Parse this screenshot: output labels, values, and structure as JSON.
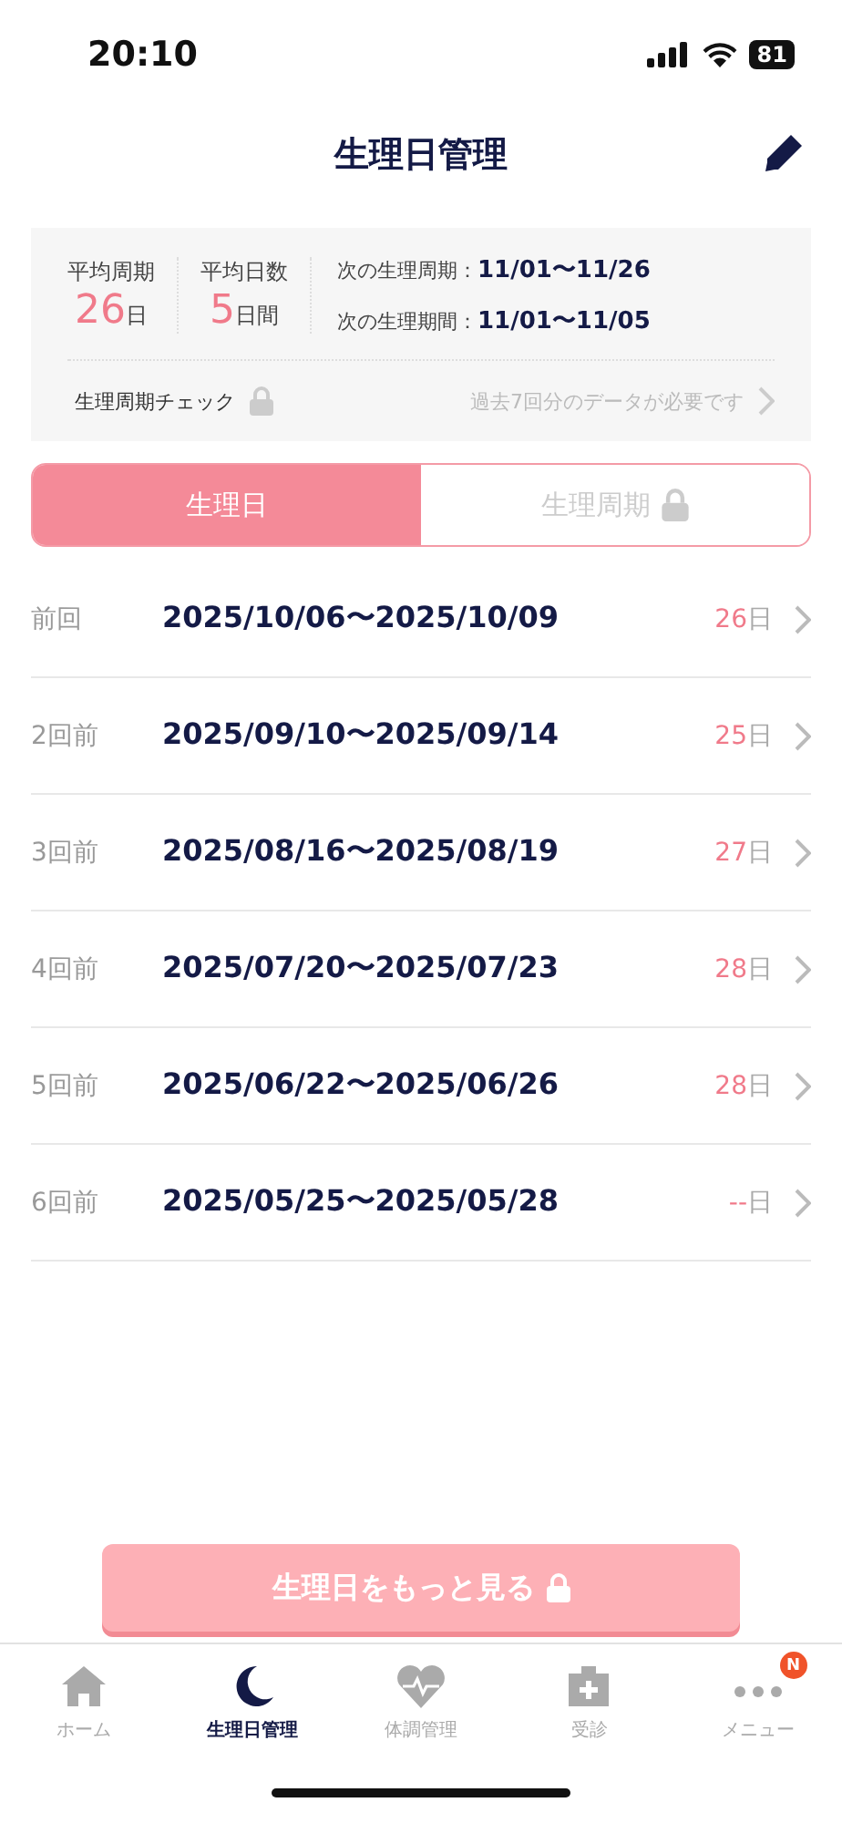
{
  "status_bar": {
    "time": "20:10",
    "battery": "81"
  },
  "header": {
    "title": "生理日管理"
  },
  "summary": {
    "stats": [
      {
        "label": "平均周期",
        "value": "26",
        "unit": "日"
      },
      {
        "label": "平均日数",
        "value": "5",
        "unit": "日間"
      }
    ],
    "next": [
      {
        "label": "次の生理周期：",
        "value": "11/01〜11/26"
      },
      {
        "label": "次の生理期間：",
        "value": "11/01〜11/05"
      }
    ],
    "check": {
      "label": "生理周期チェック",
      "locked": true,
      "note": "過去7回分のデータが必要です"
    }
  },
  "tabs": [
    {
      "label": "生理日",
      "selected": true,
      "locked": false
    },
    {
      "label": "生理周期",
      "selected": false,
      "locked": true
    }
  ],
  "rows": [
    {
      "label": "前回",
      "range": "2025/10/06〜2025/10/09",
      "days": "26",
      "unit": "日"
    },
    {
      "label": "2回前",
      "range": "2025/09/10〜2025/09/14",
      "days": "25",
      "unit": "日"
    },
    {
      "label": "3回前",
      "range": "2025/08/16〜2025/08/19",
      "days": "27",
      "unit": "日"
    },
    {
      "label": "4回前",
      "range": "2025/07/20〜2025/07/23",
      "days": "28",
      "unit": "日"
    },
    {
      "label": "5回前",
      "range": "2025/06/22〜2025/06/26",
      "days": "28",
      "unit": "日"
    },
    {
      "label": "6回前",
      "range": "2025/05/25〜2025/05/28",
      "days": "--",
      "unit": "日"
    }
  ],
  "more_button": {
    "label": "生理日をもっと見る",
    "locked": true
  },
  "nav": [
    {
      "kind": "home",
      "label": "ホーム",
      "selected": false
    },
    {
      "kind": "moon",
      "label": "生理日管理",
      "selected": true
    },
    {
      "kind": "heart",
      "label": "体調管理",
      "selected": false
    },
    {
      "kind": "clinic",
      "label": "受診",
      "selected": false
    },
    {
      "kind": "menu",
      "label": "メニュー",
      "selected": false,
      "badge": "N"
    }
  ]
}
